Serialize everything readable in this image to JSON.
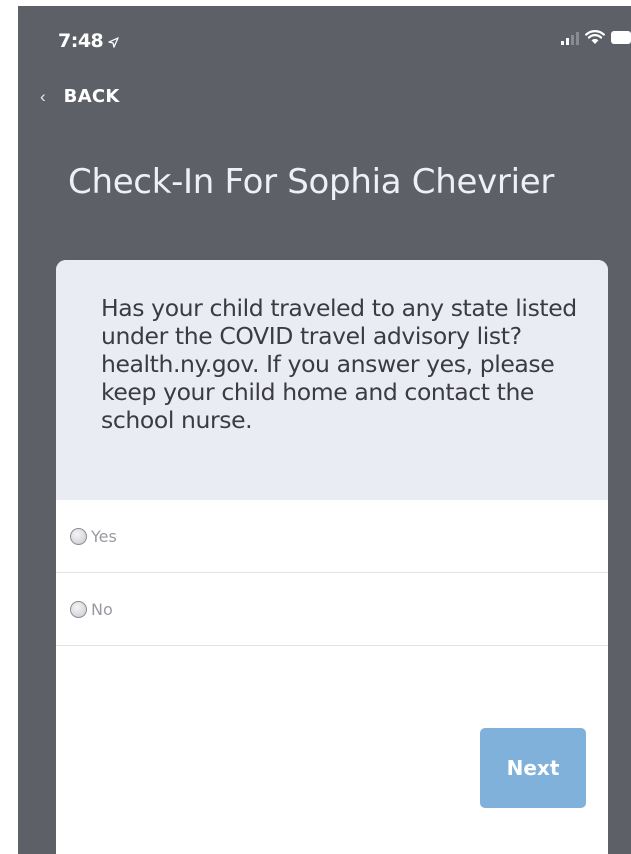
{
  "status_bar": {
    "time": "7:48"
  },
  "nav": {
    "back_label": "BACK"
  },
  "page": {
    "title": "Check-In For Sophia Chevrier"
  },
  "question": {
    "text": "Has your child traveled to any state listed under the COVID travel advisory list? health.ny.gov. If you answer yes, please keep your child home and contact the school nurse."
  },
  "options": [
    {
      "label": "Yes",
      "selected": false
    },
    {
      "label": "No",
      "selected": false
    }
  ],
  "actions": {
    "next_label": "Next",
    "next_color": "#7fb1db"
  },
  "colors": {
    "background": "#5e6068",
    "card": "#ffffff",
    "question_block": "#eaecf4"
  },
  "icons": {
    "location": "location-arrow-icon",
    "signal": "cellular-signal-icon",
    "wifi": "wifi-icon",
    "battery": "battery-icon",
    "back": "chevron-left-icon"
  }
}
